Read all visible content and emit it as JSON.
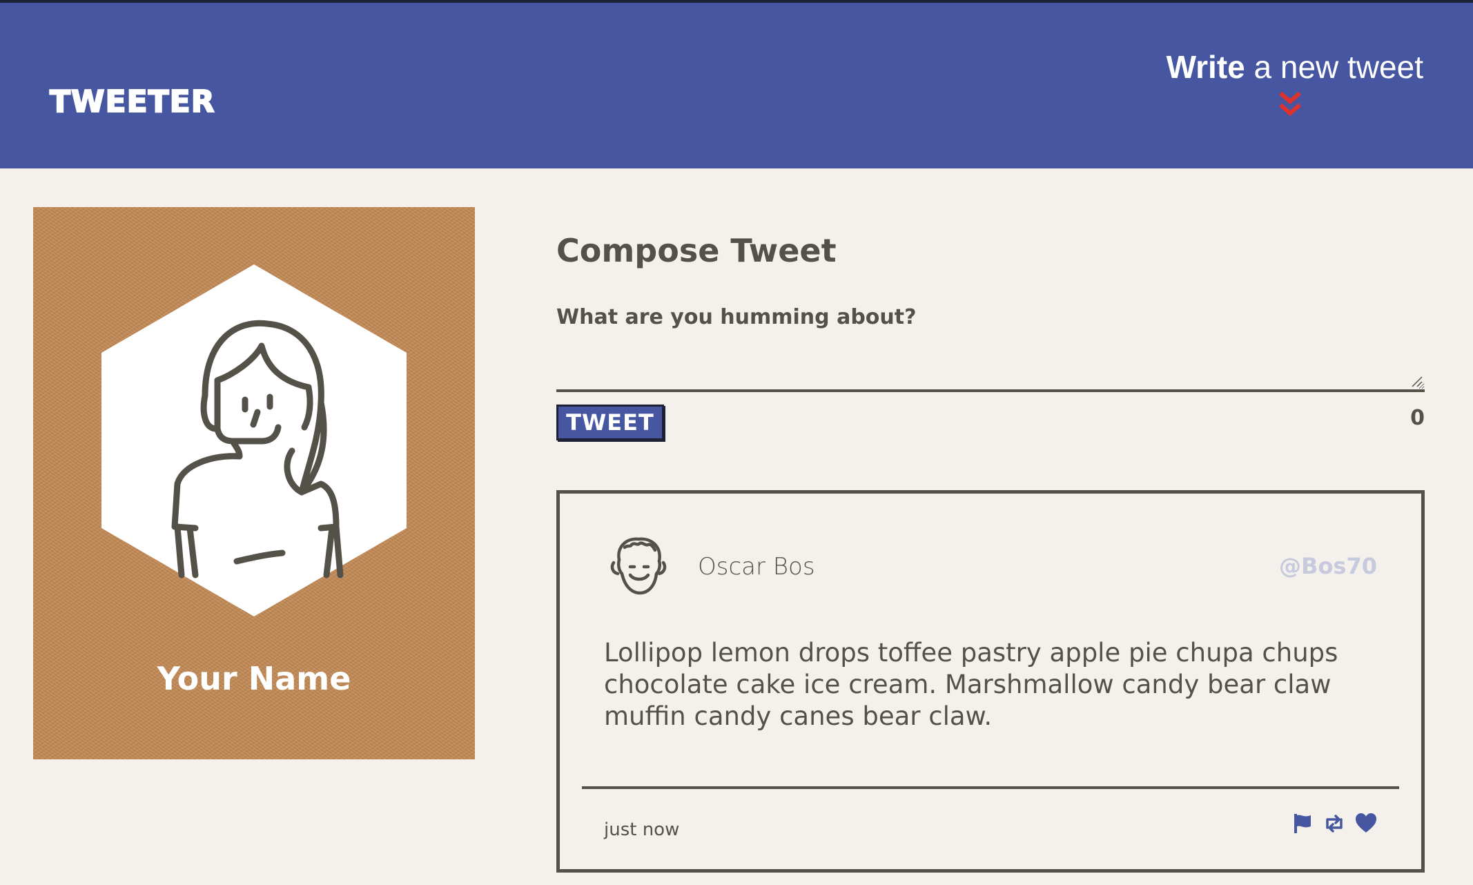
{
  "nav": {
    "logo": "TWEETER",
    "write_bold": "Write",
    "write_rest": " a new tweet"
  },
  "profile": {
    "name": "Your Name"
  },
  "compose": {
    "title": "Compose Tweet",
    "placeholder": "What are you humming about?",
    "button_label": "TWEET",
    "counter": "0"
  },
  "tweet": {
    "author_name": "Oscar Bos",
    "handle": "@Bos70",
    "body": "Lollipop lemon drops toffee pastry apple pie chupa chups chocolate cake ice cream. Marshmallow candy bear claw muffin candy canes bear claw.",
    "timestamp": "just now",
    "actions": [
      "flag-icon",
      "retweet-icon",
      "heart-icon"
    ]
  },
  "colors": {
    "nav": "#4656a0",
    "background": "#f4f1ec",
    "text": "#545149",
    "accent_red": "#e0322a",
    "profile_bg": "#c38a56",
    "handle": "#c7c9dc"
  }
}
